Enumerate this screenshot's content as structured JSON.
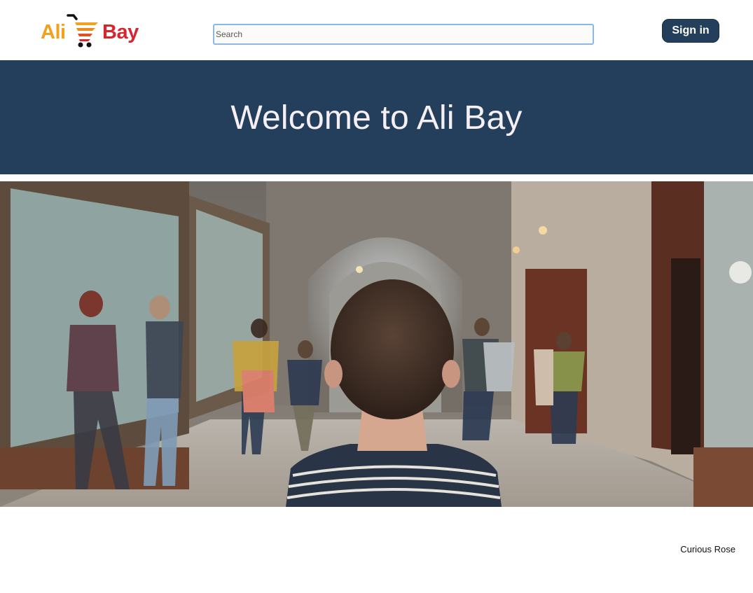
{
  "header": {
    "logo": {
      "left_text": "Ali",
      "right_text": "Bay",
      "icon": "shopping-cart-icon",
      "colors": {
        "ali": "#f2a11e",
        "bay": "#d5262e"
      }
    },
    "search": {
      "placeholder": "Search",
      "value": ""
    },
    "signin_label": "Sign in"
  },
  "banner": {
    "title": "Welcome to Ali Bay",
    "background": "#243f5b"
  },
  "hero": {
    "image": "museum-hallway-photo"
  },
  "footer": {
    "credit": "Curious Rose"
  }
}
